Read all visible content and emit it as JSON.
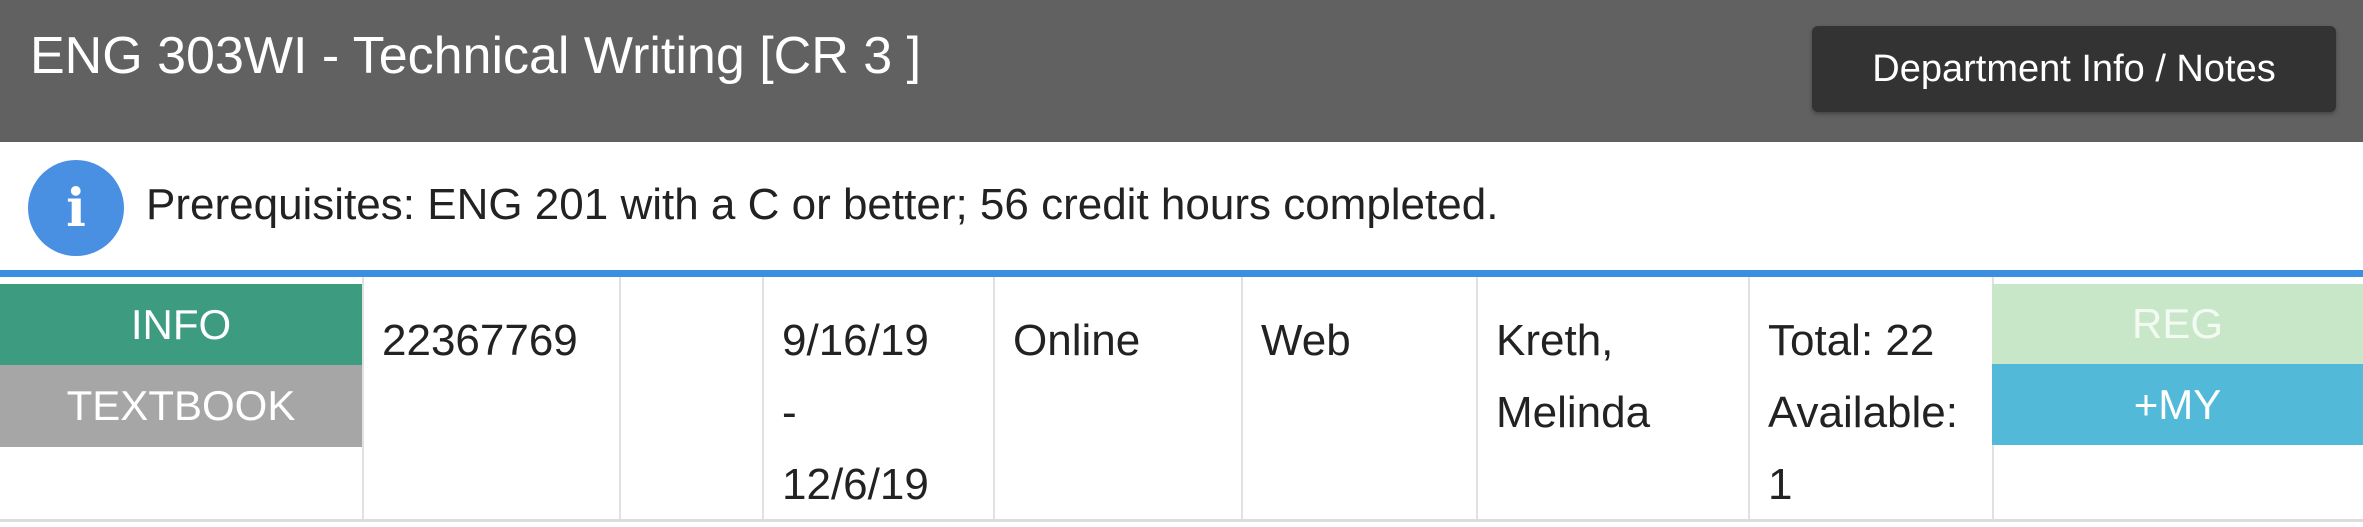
{
  "header": {
    "course_title": "ENG 303WI - Technical Writing [CR 3 ]",
    "dept_button": "Department Info / Notes"
  },
  "prereq": {
    "icon": "info-circle-icon",
    "text": "Prerequisites: ENG 201 with a C or better; 56 credit hours completed."
  },
  "section": {
    "info_button": "INFO",
    "textbook_button": "TEXTBOOK",
    "crn": "22367769",
    "days": "",
    "date_start": "9/16/19",
    "date_sep": "-",
    "date_end": "12/6/19",
    "location": "Online",
    "method": "Web",
    "instructor_last": "Kreth,",
    "instructor_first": "Melinda",
    "seats_total": "Total: 22",
    "seats_available_label": "Available:",
    "seats_available_value": "1",
    "reg_button": "REG",
    "my_button": "+MY"
  },
  "colors": {
    "header_bg": "#616161",
    "accent_blue": "#3b8fe0",
    "info_green": "#3d9b80",
    "textbook_gray": "#a6a6a6",
    "reg_disabled": "#c7e7c8",
    "my_blue": "#52b9d8"
  }
}
